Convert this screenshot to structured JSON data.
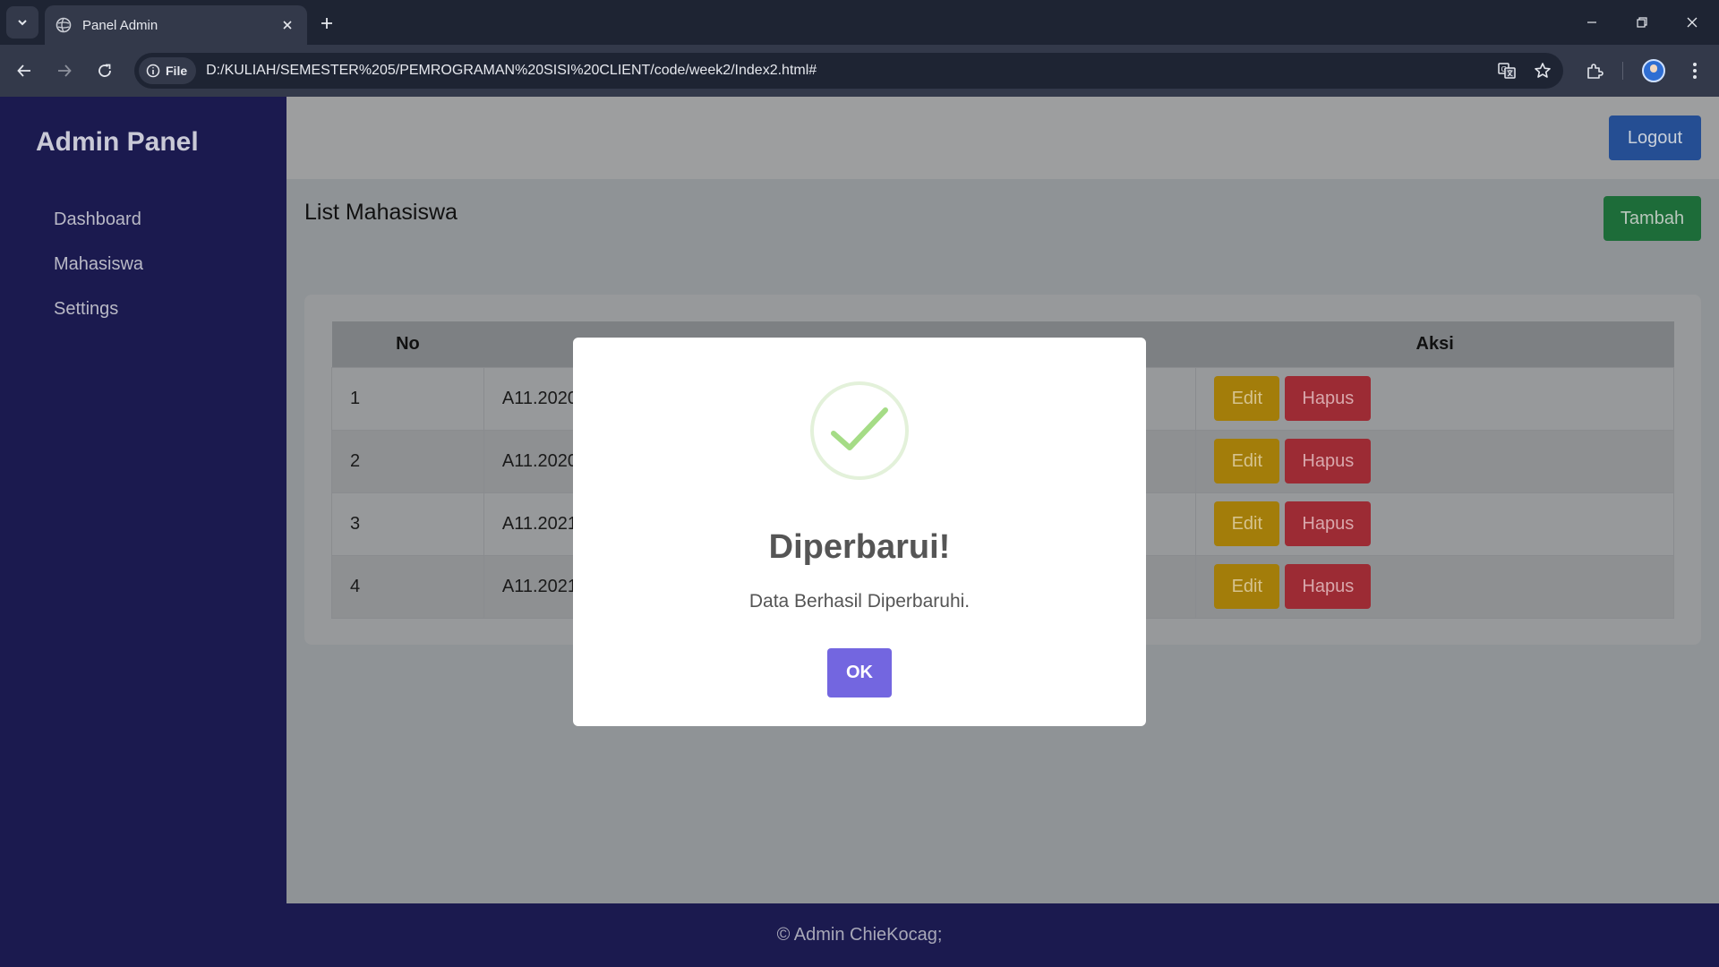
{
  "browser": {
    "tab_title": "Panel Admin",
    "site_chip": "File",
    "url": "D:/KULIAH/SEMESTER%205/PEMROGRAMAN%20SISI%20CLIENT/code/week2/Index2.html#"
  },
  "sidebar": {
    "brand": "Admin Panel",
    "items": [
      {
        "label": "Dashboard"
      },
      {
        "label": "Mahasiswa"
      },
      {
        "label": "Settings"
      }
    ]
  },
  "header": {
    "logout_label": "Logout"
  },
  "main": {
    "heading": "List Mahasiswa",
    "add_label": "Tambah",
    "table": {
      "columns": [
        "No",
        "Aksi"
      ],
      "rows": [
        {
          "no": "1",
          "nim": "A11.2020"
        },
        {
          "no": "2",
          "nim": "A11.2020"
        },
        {
          "no": "3",
          "nim": "A11.2021"
        },
        {
          "no": "4",
          "nim": "A11.2021"
        }
      ],
      "edit_label": "Edit",
      "delete_label": "Hapus"
    }
  },
  "footer": {
    "text": "© Admin ChieKocag;"
  },
  "modal": {
    "title": "Diperbarui!",
    "message": "Data Berhasil Diperbaruhi.",
    "ok_label": "OK",
    "icon": "success-check-icon"
  },
  "colors": {
    "sidebar_bg": "#1b1a4f",
    "logout_bg": "#2f62ba",
    "add_bg": "#24883f",
    "edit_bg": "#d09f0f",
    "delete_bg": "#c63640",
    "ok_button": "#7366e0",
    "success_green": "#a5dc86"
  }
}
